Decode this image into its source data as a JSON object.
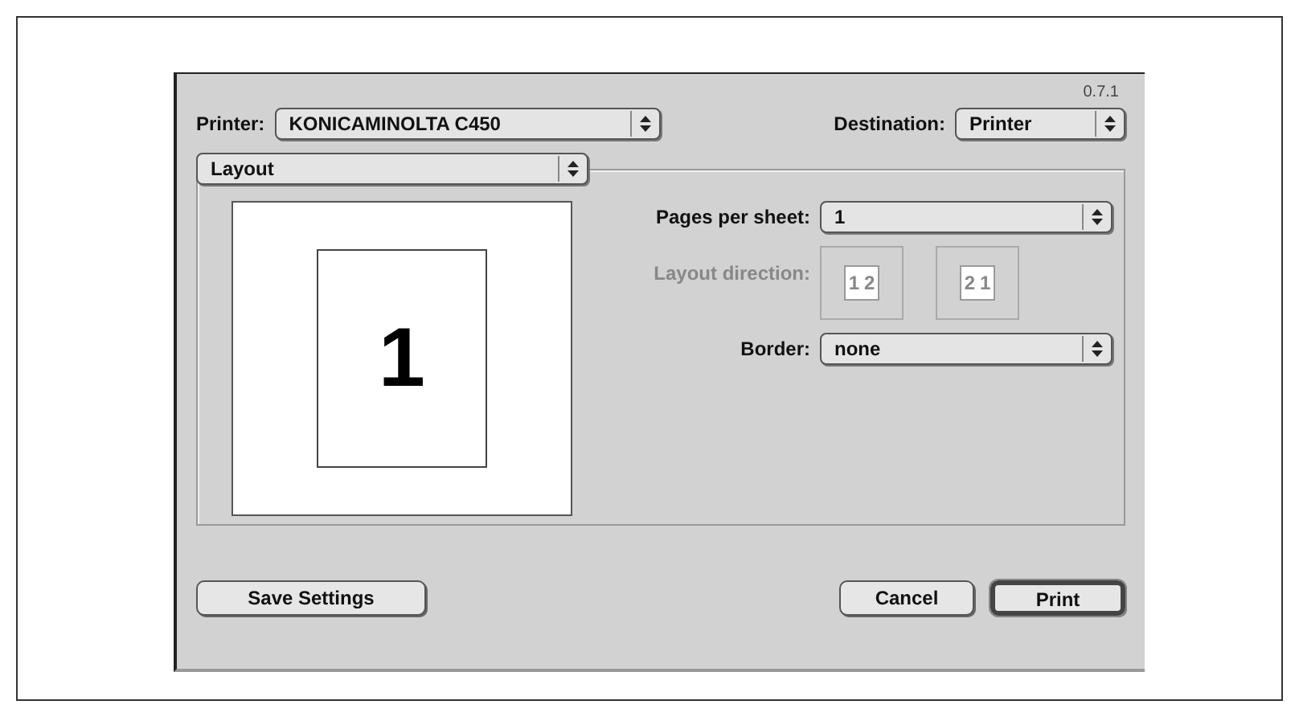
{
  "version": "0.7.1",
  "printer": {
    "label": "Printer:",
    "value": "KONICAMINOLTA C450"
  },
  "destination": {
    "label": "Destination:",
    "value": "Printer"
  },
  "panel": {
    "value": "Layout"
  },
  "preview": {
    "page_number": "1"
  },
  "pages_per_sheet": {
    "label": "Pages per sheet:",
    "value": "1"
  },
  "layout_direction": {
    "label": "Layout direction:",
    "disabled": true,
    "options": [
      {
        "pages": [
          "1",
          "2"
        ]
      },
      {
        "pages": [
          "2",
          "1"
        ]
      }
    ]
  },
  "border": {
    "label": "Border:",
    "value": "none"
  },
  "buttons_left": [
    {
      "label": "Save Settings",
      "default": false
    }
  ],
  "buttons_right": [
    {
      "label": "Cancel",
      "default": false
    },
    {
      "label": "Print",
      "default": true
    }
  ]
}
